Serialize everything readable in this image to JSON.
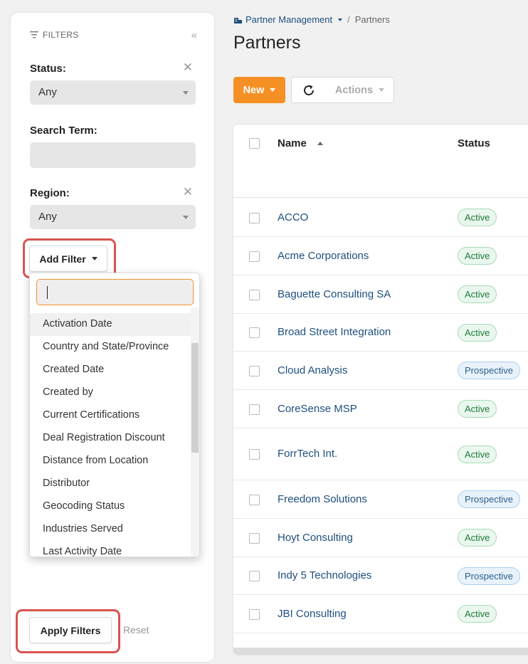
{
  "filters": {
    "header_label": "FILTERS",
    "status": {
      "label": "Status:",
      "value": "Any"
    },
    "search_term": {
      "label": "Search Term:",
      "value": ""
    },
    "region": {
      "label": "Region:",
      "value": "Any"
    },
    "add_filter_label": "Add Filter",
    "add_filter_options": [
      "Activation Date",
      "Country and State/Province",
      "Created Date",
      "Created by",
      "Current Certifications",
      "Deal Registration Discount",
      "Distance from Location",
      "Distributor",
      "Geocoding Status",
      "Industries Served",
      "Last Activity Date"
    ],
    "apply_label": "Apply Filters",
    "reset_label": "Reset"
  },
  "breadcrumb": {
    "parent": "Partner Management",
    "current": "Partners"
  },
  "page_title": "Partners",
  "toolbar": {
    "new_label": "New",
    "actions_label": "Actions"
  },
  "table": {
    "headers": {
      "name": "Name",
      "status": "Status"
    },
    "rows": [
      {
        "name": "ACCO",
        "status": "Active"
      },
      {
        "name": "Acme Corporations",
        "status": "Active"
      },
      {
        "name": "Baguette Consulting SA",
        "status": "Active"
      },
      {
        "name": "Broad Street Integration",
        "status": "Active"
      },
      {
        "name": "Cloud Analysis",
        "status": "Prospective"
      },
      {
        "name": "CoreSense MSP",
        "status": "Active"
      },
      {
        "name": "ForrTech Int.",
        "status": "Active"
      },
      {
        "name": "Freedom Solutions",
        "status": "Prospective"
      },
      {
        "name": "Hoyt Consulting",
        "status": "Active"
      },
      {
        "name": "Indy 5 Technologies",
        "status": "Prospective"
      },
      {
        "name": "JBI Consulting",
        "status": "Active"
      }
    ]
  },
  "colors": {
    "accent_orange": "#f59024",
    "highlight_red": "#d9534f",
    "link_blue": "#1e4f7e",
    "active_green": "#1e7b3b",
    "prospective_blue": "#2c5e8c"
  }
}
